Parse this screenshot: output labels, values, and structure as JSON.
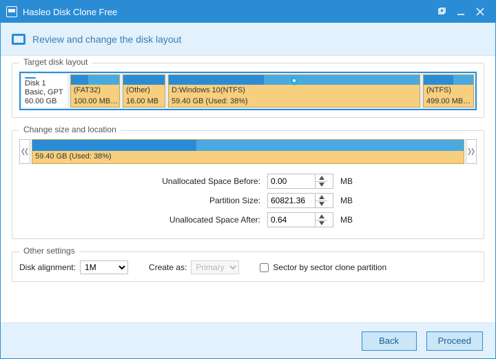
{
  "app": {
    "title": "Hasleo Disk Clone Free"
  },
  "subtitle": "Review and change the disk layout",
  "groups": {
    "target": "Target disk layout",
    "resize": "Change size and location",
    "other": "Other settings"
  },
  "disk": {
    "name": "Disk 1",
    "type": "Basic, GPT",
    "size": "60.00 GB"
  },
  "partitions": [
    {
      "fs": "(FAT32)",
      "size": "100.00 MB…",
      "used_pct": 35
    },
    {
      "fs": "(Other)",
      "size": "16.00 MB",
      "used_pct": 100
    },
    {
      "fs": "D:Windows 10(NTFS)",
      "size": "59.40 GB (Used: 38%)",
      "used_pct": 38
    },
    {
      "fs": "(NTFS)",
      "size": "499.00 MB…",
      "used_pct": 60
    }
  ],
  "slider": {
    "label": "59.40 GB (Used: 38%)",
    "used_pct": 38
  },
  "fields": {
    "before_label": "Unallocated Space Before:",
    "before_value": "0.00",
    "size_label": "Partition Size:",
    "size_value": "60821.36",
    "after_label": "Unallocated Space After:",
    "after_value": "0.64",
    "unit": "MB"
  },
  "other": {
    "alignment_label": "Disk alignment:",
    "alignment_value": "1M",
    "create_as_label": "Create as:",
    "create_as_value": "Primary",
    "sector_label": "Sector by sector clone partition",
    "sector_checked": false
  },
  "buttons": {
    "back": "Back",
    "proceed": "Proceed"
  }
}
